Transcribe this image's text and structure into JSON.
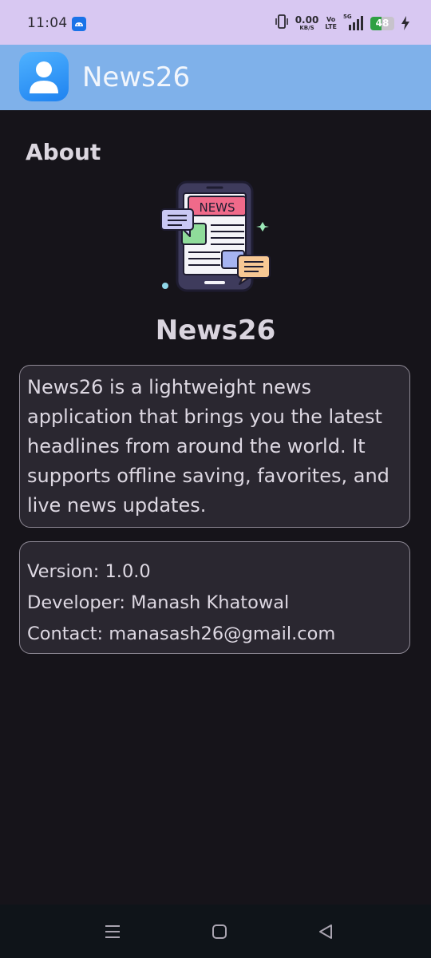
{
  "status_bar": {
    "time": "11:04",
    "net_speed_value": "0.00",
    "net_speed_unit": "KB/S",
    "volte_top": "Vo",
    "volte_bottom": "LTE",
    "network_type": "5G",
    "battery_level": "48",
    "battery_fraction": 0.48,
    "battery_color": "#2ea043",
    "icons": [
      "android-notification-icon",
      "vibrate-icon",
      "signal-icon",
      "battery-icon",
      "charging-icon"
    ]
  },
  "app_bar": {
    "title": "News26",
    "background": "#7fb1ea",
    "avatar_icon": "person-icon"
  },
  "about": {
    "heading": "About",
    "illustration": {
      "badge_text": "NEWS",
      "icon": "news-phone-illustration"
    },
    "app_name": "News26",
    "description": "News26 is a lightweight news application that brings you the latest headlines from around the world. It supports offline saving, favorites, and live news updates.",
    "info": {
      "version": "Version: 1.0.0",
      "developer": "Developer: Manash Khatowal",
      "contact": "Contact: manasash26@gmail.com"
    }
  },
  "nav_bar": {
    "icons": [
      "recents-icon",
      "home-icon",
      "back-icon"
    ]
  }
}
